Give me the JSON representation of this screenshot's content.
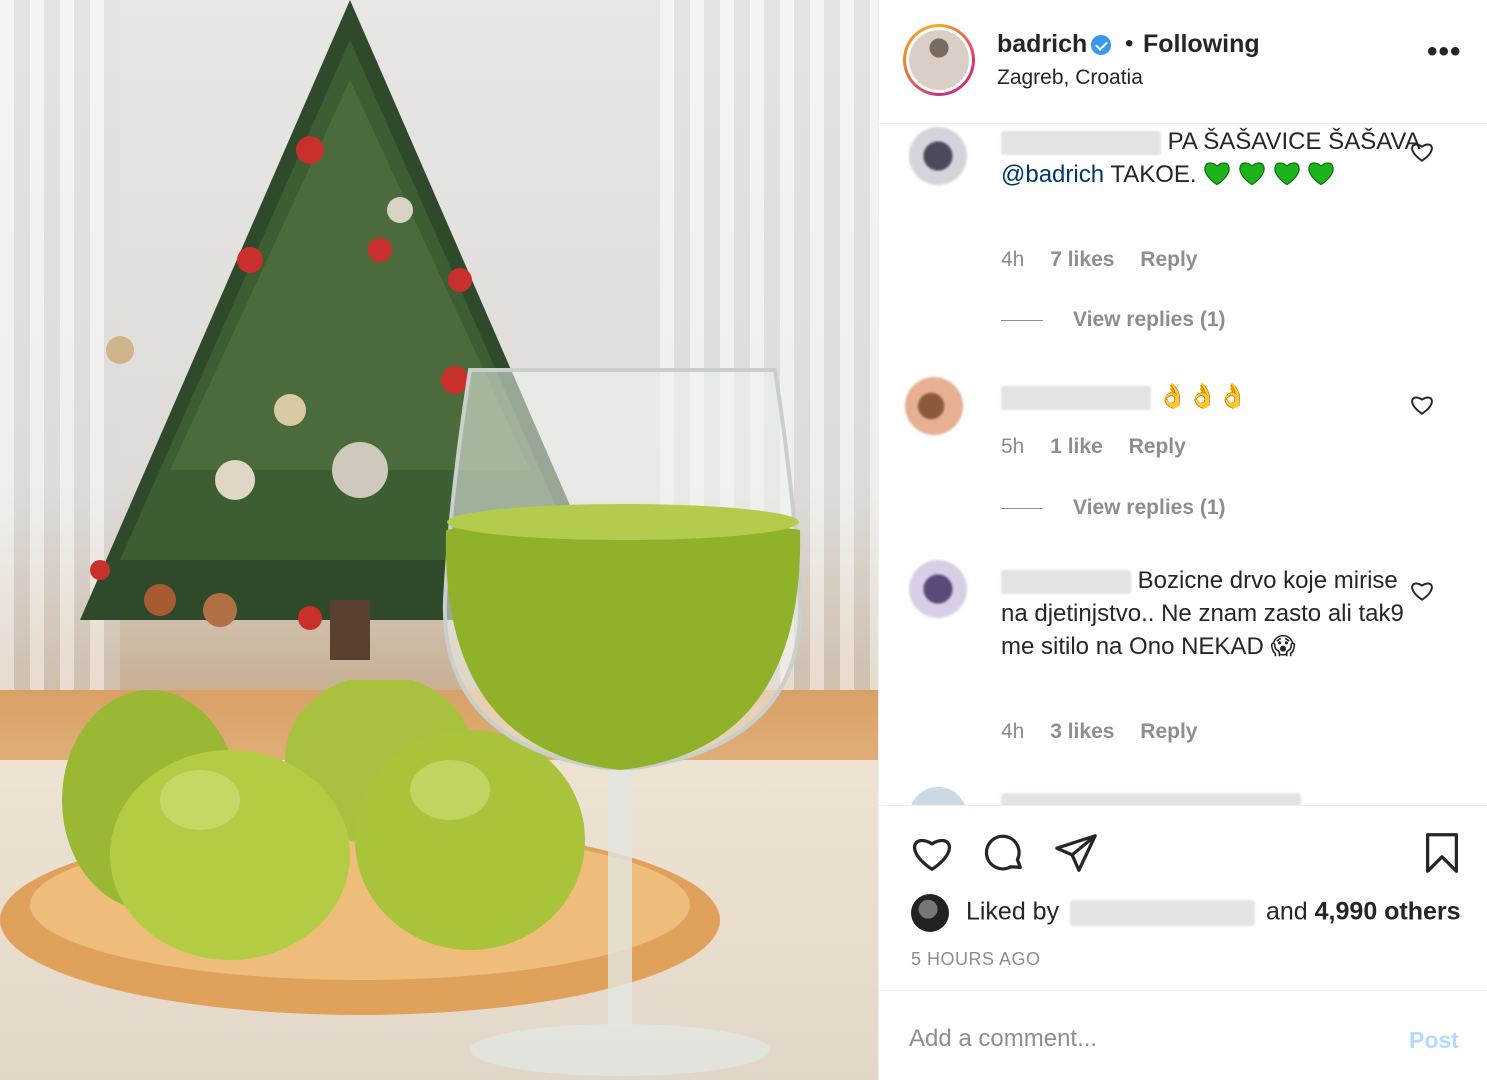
{
  "post": {
    "username": "badrich",
    "separator": "•",
    "follow_state": "Following",
    "location": "Zagreb, Croatia",
    "more": "•••"
  },
  "comments": [
    {
      "text_before": "PA ŠAŠAVICE ŠAŠAVA",
      "mention": "@badrich",
      "text_after": "TAKOE.",
      "emoji": "green-heart x4",
      "time": "4h",
      "likes": "7 likes",
      "reply": "Reply",
      "view_replies": "View replies (1)"
    },
    {
      "emoji_text": "👌👌👌",
      "time": "5h",
      "likes": "1 like",
      "reply": "Reply",
      "view_replies": "View replies (1)"
    },
    {
      "text": "Bozicne drvo koje mirise na djetinjstvo.. Ne znam zasto ali tak9 me sitilo na Ono NEKAD",
      "emoji_text": "😱",
      "time": "4h",
      "likes": "3 likes",
      "reply": "Reply"
    }
  ],
  "likes": {
    "prefix": "Liked by",
    "suffix": "and",
    "others": "4,990 others"
  },
  "time_ago": "5 HOURS AGO",
  "add_comment": {
    "placeholder": "Add a comment...",
    "post_label": "Post"
  },
  "colors": {
    "verified": "#3897f0",
    "mention": "#00376b",
    "muted": "#8e8e8e",
    "post_disabled": "#b3dbff",
    "green_heart": "#1db31d"
  }
}
